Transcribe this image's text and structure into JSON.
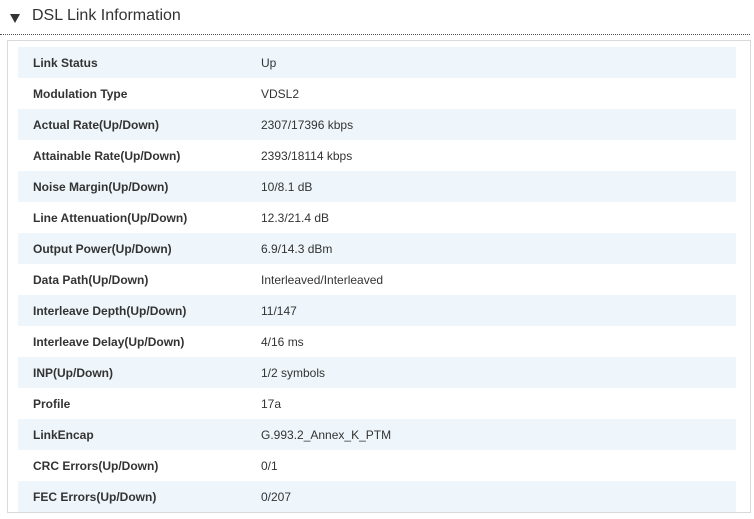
{
  "section": {
    "title": "DSL Link Information",
    "toggle_icon": "triangle-down-icon"
  },
  "colors": {
    "row_shade": "#eef6fb",
    "row_plain": "#ffffff",
    "text": "#333333",
    "border": "#d9d9d9"
  },
  "rows": [
    {
      "label": "Link Status",
      "value": "Up"
    },
    {
      "label": "Modulation Type",
      "value": "VDSL2"
    },
    {
      "label": "Actual Rate(Up/Down)",
      "value": "2307/17396 kbps"
    },
    {
      "label": "Attainable Rate(Up/Down)",
      "value": "2393/18114 kbps"
    },
    {
      "label": "Noise Margin(Up/Down)",
      "value": "10/8.1 dB"
    },
    {
      "label": "Line Attenuation(Up/Down)",
      "value": "12.3/21.4 dB"
    },
    {
      "label": "Output Power(Up/Down)",
      "value": "6.9/14.3 dBm"
    },
    {
      "label": "Data Path(Up/Down)",
      "value": "Interleaved/Interleaved"
    },
    {
      "label": "Interleave Depth(Up/Down)",
      "value": "11/147"
    },
    {
      "label": "Interleave Delay(Up/Down)",
      "value": "4/16 ms"
    },
    {
      "label": "INP(Up/Down)",
      "value": "1/2 symbols"
    },
    {
      "label": "Profile",
      "value": "17a"
    },
    {
      "label": "LinkEncap",
      "value": "G.993.2_Annex_K_PTM"
    },
    {
      "label": "CRC Errors(Up/Down)",
      "value": "0/1"
    },
    {
      "label": "FEC Errors(Up/Down)",
      "value": "0/207"
    }
  ]
}
